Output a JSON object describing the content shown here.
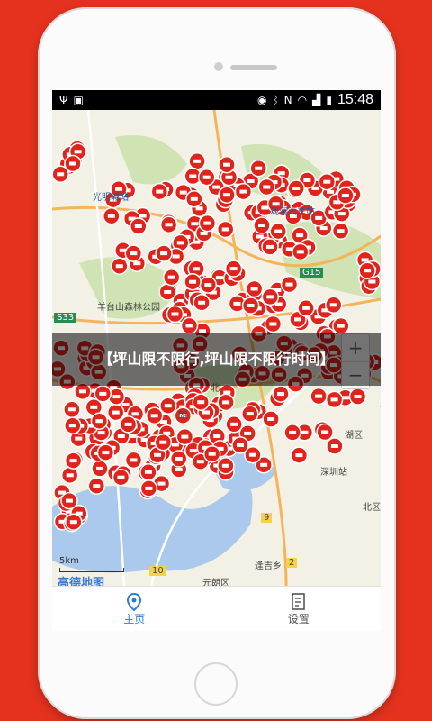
{
  "status_bar": {
    "time": "15:48",
    "left_icons": [
      "usb-icon",
      "sim-icon"
    ],
    "right_icons": [
      "eye-icon",
      "bluetooth-icon",
      "nfc-icon",
      "wifi-icon",
      "signal-icon",
      "battery-icon"
    ]
  },
  "map": {
    "labels": {
      "guangming": "光明城站",
      "guanlan": "观澜汽车站",
      "yangtai": "羊台山森林公园",
      "g15": "G15",
      "s33": "S33",
      "lang": "朗",
      "hu": "湖区",
      "shenzhen": "深圳站",
      "yuanlang": "元朗区",
      "fenggu": "逢吉乡",
      "n9": "9",
      "n10": "10",
      "n2": "2",
      "bei": "北区",
      "b1": "北"
    },
    "scale_text": "5km",
    "logo_text": "高德地图",
    "zoom_in": "+",
    "zoom_out": "−"
  },
  "overlay": {
    "title": "【坪山限不限行,坪山限不限行时间】"
  },
  "tabs": [
    {
      "label": "主页",
      "icon": "location-pin-icon",
      "active": true
    },
    {
      "label": "设置",
      "icon": "settings-doc-icon",
      "active": false
    }
  ],
  "colors": {
    "background": "#e5321f",
    "marker": "#e0241b",
    "accent": "#2d79d8"
  }
}
